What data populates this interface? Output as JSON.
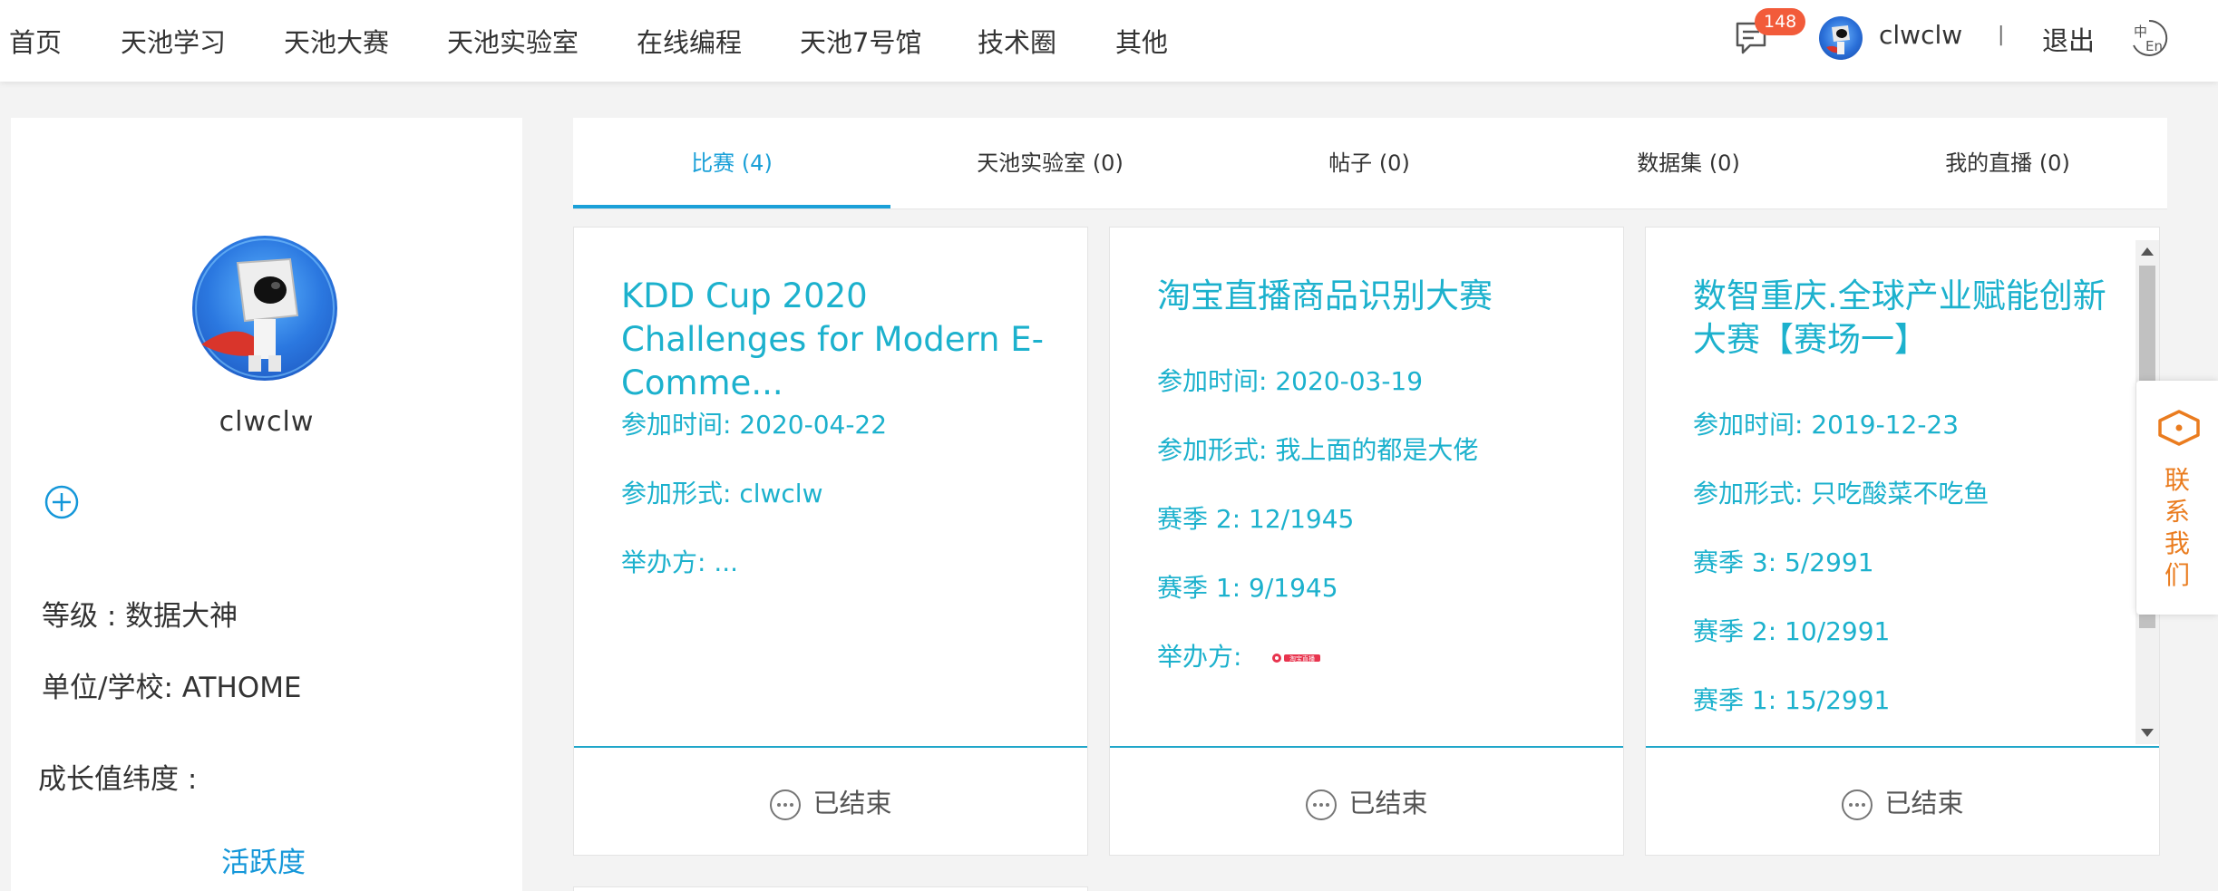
{
  "nav": {
    "items": [
      "首页",
      "天池学习",
      "天池大赛",
      "天池实验室",
      "在线编程",
      "天池7号馆",
      "技术圈",
      "其他"
    ],
    "message_count": "148",
    "username": "clwclw",
    "separator": "|",
    "logout": "退出",
    "lang_icon": "language-toggle-icon"
  },
  "profile": {
    "name": "clwclw",
    "level": "等级 : 数据大神",
    "org": "单位/学校: ATHOME",
    "growth": "成长值纬度 :",
    "activity": "活跃度"
  },
  "tabs": [
    "比赛 (4)",
    "天池实验室 (0)",
    "帖子 (0)",
    "数据集 (0)",
    "我的直播 (0)"
  ],
  "cards": [
    {
      "title": "KDD Cup 2020 Challenges for Modern E-Comme...",
      "lines": [
        "参加时间: 2020-04-22",
        "参加形式: clwclw",
        "举办方: ..."
      ],
      "status": "已结束"
    },
    {
      "title": "淘宝直播商品识别大赛",
      "lines": [
        "参加时间: 2020-03-19",
        "参加形式: 我上面的都是大佬",
        "赛季 2: 12/1945",
        "赛季 1: 9/1945",
        "举办方:"
      ],
      "host_logo": "淘宝直播",
      "status": "已结束"
    },
    {
      "title": "数智重庆.全球产业赋能创新大赛【赛场一】",
      "lines": [
        "参加时间: 2019-12-23",
        "参加形式: 只吃酸菜不吃鱼",
        "赛季 3: 5/2991",
        "赛季 2: 10/2991",
        "赛季 1: 15/2991"
      ],
      "status": "已结束"
    }
  ],
  "contact": "联系我们",
  "colors": {
    "accent": "#1aa0d8",
    "card_text": "#1cb1cd",
    "badge": "#f25b3a",
    "contact": "#ea7c1f"
  }
}
